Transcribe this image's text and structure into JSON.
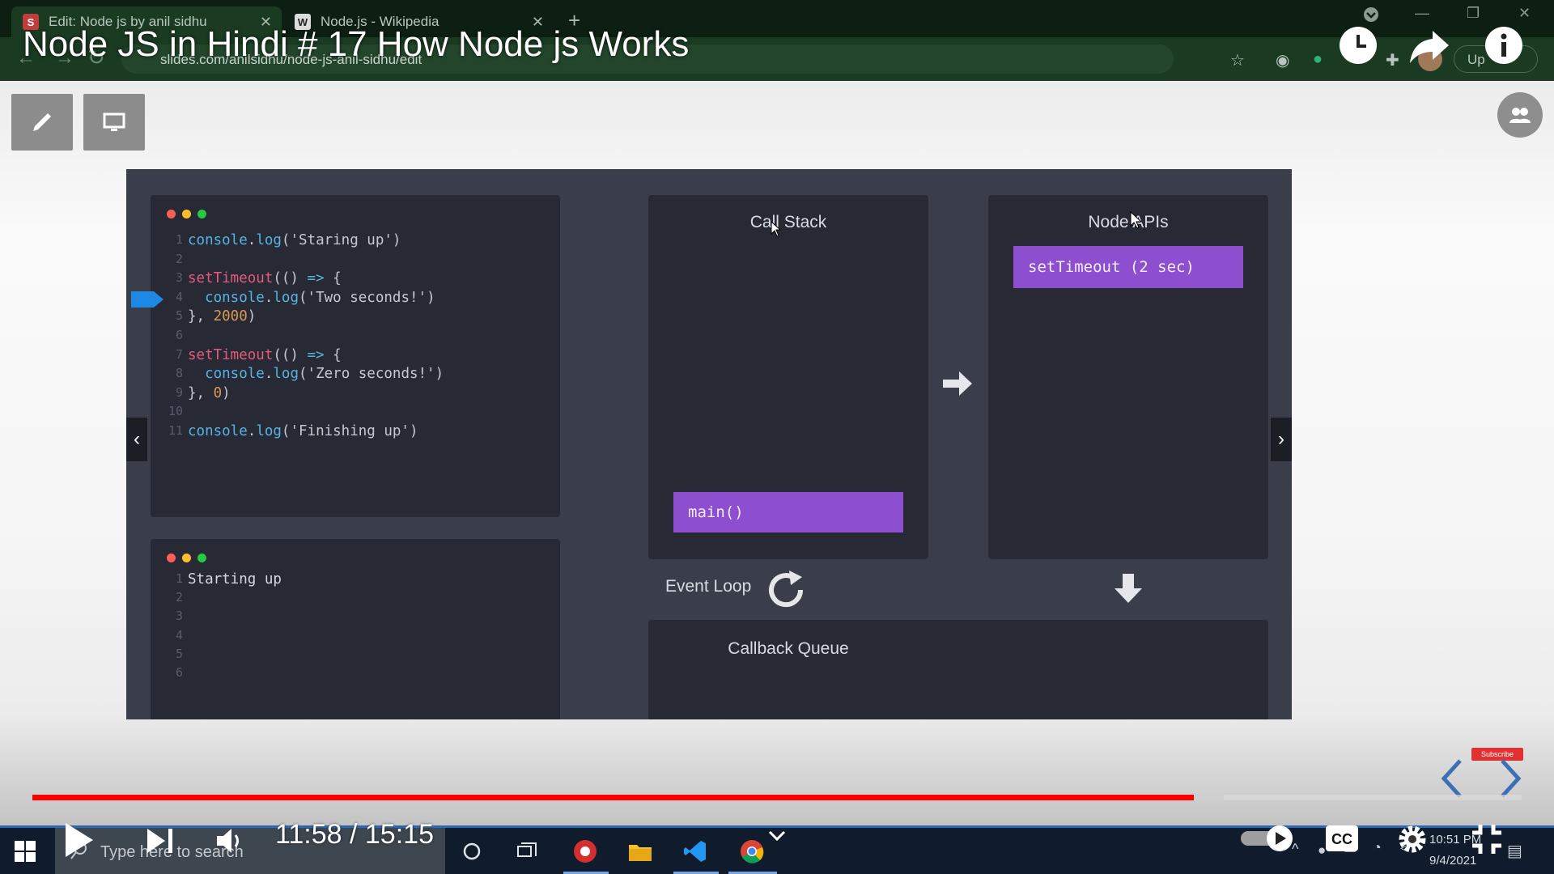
{
  "browser": {
    "tabs": [
      {
        "label": "Edit: Node js by anil sidhu",
        "favicon": "S",
        "favicon_color": "#c13c3c",
        "active": true
      },
      {
        "label": "Node.js - Wikipedia",
        "favicon": "W",
        "favicon_color": "#dddddd",
        "active": false
      }
    ],
    "new_tab": "+",
    "url": "slides.com/anilsidhu/node-js-anil-sidhu/edit",
    "update_button": "Up"
  },
  "youtube": {
    "title": "Node JS in Hindi # 17 How Node js Works",
    "time_current": "11:58",
    "time_total": "15:15",
    "time_display": "11:58 / 15:15",
    "progress_played": 0.78,
    "progress_buffered": 0.8,
    "subscribe_badge": "Subscribe"
  },
  "slide": {
    "code_lines": [
      {
        "n": "1",
        "parts": [
          [
            "fn",
            "console"
          ],
          [
            "pun",
            "."
          ],
          [
            "fn",
            "log"
          ],
          [
            "pun",
            "("
          ],
          [
            "str",
            "'Staring up'"
          ],
          [
            "pun",
            ")"
          ]
        ]
      },
      {
        "n": "2",
        "parts": []
      },
      {
        "n": "3",
        "parts": [
          [
            "kw",
            "setTimeout"
          ],
          [
            "pun",
            "(() "
          ],
          [
            "fn",
            "=>"
          ],
          [
            "pun",
            " {"
          ]
        ]
      },
      {
        "n": "4",
        "parts": [
          [
            "plain",
            "  "
          ],
          [
            "fn",
            "console"
          ],
          [
            "pun",
            "."
          ],
          [
            "fn",
            "log"
          ],
          [
            "pun",
            "("
          ],
          [
            "str",
            "'Two seconds!'"
          ],
          [
            "pun",
            ")"
          ]
        ]
      },
      {
        "n": "5",
        "parts": [
          [
            "pun",
            "}, "
          ],
          [
            "num",
            "2000"
          ],
          [
            "pun",
            ")"
          ]
        ]
      },
      {
        "n": "6",
        "parts": []
      },
      {
        "n": "7",
        "parts": [
          [
            "kw",
            "setTimeout"
          ],
          [
            "pun",
            "(() "
          ],
          [
            "fn",
            "=>"
          ],
          [
            "pun",
            " {"
          ]
        ]
      },
      {
        "n": "8",
        "parts": [
          [
            "plain",
            "  "
          ],
          [
            "fn",
            "console"
          ],
          [
            "pun",
            "."
          ],
          [
            "fn",
            "log"
          ],
          [
            "pun",
            "("
          ],
          [
            "str",
            "'Zero seconds!'"
          ],
          [
            "pun",
            ")"
          ]
        ]
      },
      {
        "n": "9",
        "parts": [
          [
            "pun",
            "}, "
          ],
          [
            "num",
            "0"
          ],
          [
            "pun",
            ")"
          ]
        ]
      },
      {
        "n": "10",
        "parts": []
      },
      {
        "n": "11",
        "parts": [
          [
            "fn",
            "console"
          ],
          [
            "pun",
            "."
          ],
          [
            "fn",
            "log"
          ],
          [
            "pun",
            "("
          ],
          [
            "str",
            "'Finishing up'"
          ],
          [
            "pun",
            ")"
          ]
        ]
      }
    ],
    "console_lines": [
      {
        "n": "1",
        "text": "Starting up"
      },
      {
        "n": "2",
        "text": ""
      },
      {
        "n": "3",
        "text": ""
      },
      {
        "n": "4",
        "text": ""
      },
      {
        "n": "5",
        "text": ""
      },
      {
        "n": "6",
        "text": ""
      }
    ],
    "call_stack_title": "Call Stack",
    "call_stack_item": "main()",
    "node_apis_title": "Node APIs",
    "node_apis_item": "setTimeout (2 sec)",
    "event_loop_label": "Event Loop",
    "callback_queue_title": "Callback Queue",
    "accent_purple": "#8d4fcf"
  },
  "taskbar": {
    "search_placeholder": "Type here to search",
    "clock_time": "10:51 PM",
    "clock_date": "9/4/2021"
  }
}
